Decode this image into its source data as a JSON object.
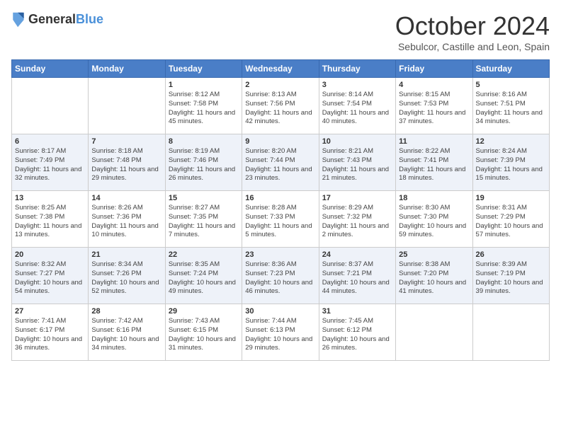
{
  "header": {
    "logo_general": "General",
    "logo_blue": "Blue",
    "month": "October 2024",
    "location": "Sebulcor, Castille and Leon, Spain"
  },
  "weekdays": [
    "Sunday",
    "Monday",
    "Tuesday",
    "Wednesday",
    "Thursday",
    "Friday",
    "Saturday"
  ],
  "weeks": [
    [
      {
        "day": "",
        "info": ""
      },
      {
        "day": "",
        "info": ""
      },
      {
        "day": "1",
        "info": "Sunrise: 8:12 AM\nSunset: 7:58 PM\nDaylight: 11 hours and 45 minutes."
      },
      {
        "day": "2",
        "info": "Sunrise: 8:13 AM\nSunset: 7:56 PM\nDaylight: 11 hours and 42 minutes."
      },
      {
        "day": "3",
        "info": "Sunrise: 8:14 AM\nSunset: 7:54 PM\nDaylight: 11 hours and 40 minutes."
      },
      {
        "day": "4",
        "info": "Sunrise: 8:15 AM\nSunset: 7:53 PM\nDaylight: 11 hours and 37 minutes."
      },
      {
        "day": "5",
        "info": "Sunrise: 8:16 AM\nSunset: 7:51 PM\nDaylight: 11 hours and 34 minutes."
      }
    ],
    [
      {
        "day": "6",
        "info": "Sunrise: 8:17 AM\nSunset: 7:49 PM\nDaylight: 11 hours and 32 minutes."
      },
      {
        "day": "7",
        "info": "Sunrise: 8:18 AM\nSunset: 7:48 PM\nDaylight: 11 hours and 29 minutes."
      },
      {
        "day": "8",
        "info": "Sunrise: 8:19 AM\nSunset: 7:46 PM\nDaylight: 11 hours and 26 minutes."
      },
      {
        "day": "9",
        "info": "Sunrise: 8:20 AM\nSunset: 7:44 PM\nDaylight: 11 hours and 23 minutes."
      },
      {
        "day": "10",
        "info": "Sunrise: 8:21 AM\nSunset: 7:43 PM\nDaylight: 11 hours and 21 minutes."
      },
      {
        "day": "11",
        "info": "Sunrise: 8:22 AM\nSunset: 7:41 PM\nDaylight: 11 hours and 18 minutes."
      },
      {
        "day": "12",
        "info": "Sunrise: 8:24 AM\nSunset: 7:39 PM\nDaylight: 11 hours and 15 minutes."
      }
    ],
    [
      {
        "day": "13",
        "info": "Sunrise: 8:25 AM\nSunset: 7:38 PM\nDaylight: 11 hours and 13 minutes."
      },
      {
        "day": "14",
        "info": "Sunrise: 8:26 AM\nSunset: 7:36 PM\nDaylight: 11 hours and 10 minutes."
      },
      {
        "day": "15",
        "info": "Sunrise: 8:27 AM\nSunset: 7:35 PM\nDaylight: 11 hours and 7 minutes."
      },
      {
        "day": "16",
        "info": "Sunrise: 8:28 AM\nSunset: 7:33 PM\nDaylight: 11 hours and 5 minutes."
      },
      {
        "day": "17",
        "info": "Sunrise: 8:29 AM\nSunset: 7:32 PM\nDaylight: 11 hours and 2 minutes."
      },
      {
        "day": "18",
        "info": "Sunrise: 8:30 AM\nSunset: 7:30 PM\nDaylight: 10 hours and 59 minutes."
      },
      {
        "day": "19",
        "info": "Sunrise: 8:31 AM\nSunset: 7:29 PM\nDaylight: 10 hours and 57 minutes."
      }
    ],
    [
      {
        "day": "20",
        "info": "Sunrise: 8:32 AM\nSunset: 7:27 PM\nDaylight: 10 hours and 54 minutes."
      },
      {
        "day": "21",
        "info": "Sunrise: 8:34 AM\nSunset: 7:26 PM\nDaylight: 10 hours and 52 minutes."
      },
      {
        "day": "22",
        "info": "Sunrise: 8:35 AM\nSunset: 7:24 PM\nDaylight: 10 hours and 49 minutes."
      },
      {
        "day": "23",
        "info": "Sunrise: 8:36 AM\nSunset: 7:23 PM\nDaylight: 10 hours and 46 minutes."
      },
      {
        "day": "24",
        "info": "Sunrise: 8:37 AM\nSunset: 7:21 PM\nDaylight: 10 hours and 44 minutes."
      },
      {
        "day": "25",
        "info": "Sunrise: 8:38 AM\nSunset: 7:20 PM\nDaylight: 10 hours and 41 minutes."
      },
      {
        "day": "26",
        "info": "Sunrise: 8:39 AM\nSunset: 7:19 PM\nDaylight: 10 hours and 39 minutes."
      }
    ],
    [
      {
        "day": "27",
        "info": "Sunrise: 7:41 AM\nSunset: 6:17 PM\nDaylight: 10 hours and 36 minutes."
      },
      {
        "day": "28",
        "info": "Sunrise: 7:42 AM\nSunset: 6:16 PM\nDaylight: 10 hours and 34 minutes."
      },
      {
        "day": "29",
        "info": "Sunrise: 7:43 AM\nSunset: 6:15 PM\nDaylight: 10 hours and 31 minutes."
      },
      {
        "day": "30",
        "info": "Sunrise: 7:44 AM\nSunset: 6:13 PM\nDaylight: 10 hours and 29 minutes."
      },
      {
        "day": "31",
        "info": "Sunrise: 7:45 AM\nSunset: 6:12 PM\nDaylight: 10 hours and 26 minutes."
      },
      {
        "day": "",
        "info": ""
      },
      {
        "day": "",
        "info": ""
      }
    ]
  ]
}
